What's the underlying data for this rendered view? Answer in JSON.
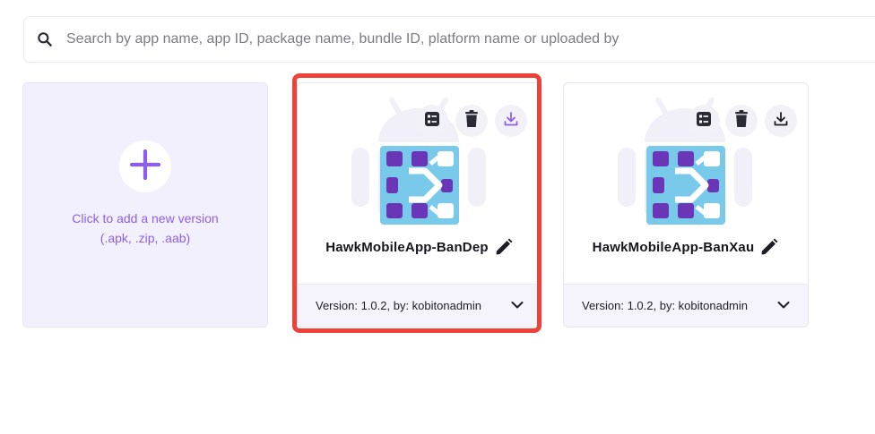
{
  "search": {
    "placeholder": "Search by app name, app ID, package name, bundle ID, platform name or uploaded by"
  },
  "add_card": {
    "line1": "Click to add a new version",
    "line2": "(.apk, .zip, .aab)"
  },
  "apps": [
    {
      "name": "HawkMobileApp-BanDep",
      "version_text": "Version: 1.0.2, by: kobitonadmin",
      "highlighted": true
    },
    {
      "name": "HawkMobileApp-BanXau",
      "version_text": "Version: 1.0.2, by: kobitonadmin",
      "highlighted": false
    }
  ],
  "colors": {
    "accent": "#8c5fe6",
    "highlight": "#ee4137",
    "icon_bg": "#78c9ea",
    "icon_block": "#6a35b7"
  },
  "icons": {
    "search": "search-icon",
    "add": "plus-icon",
    "details": "details-icon",
    "delete": "trash-icon",
    "download": "download-icon",
    "edit": "pencil-icon",
    "expand": "chevron-down-icon"
  }
}
